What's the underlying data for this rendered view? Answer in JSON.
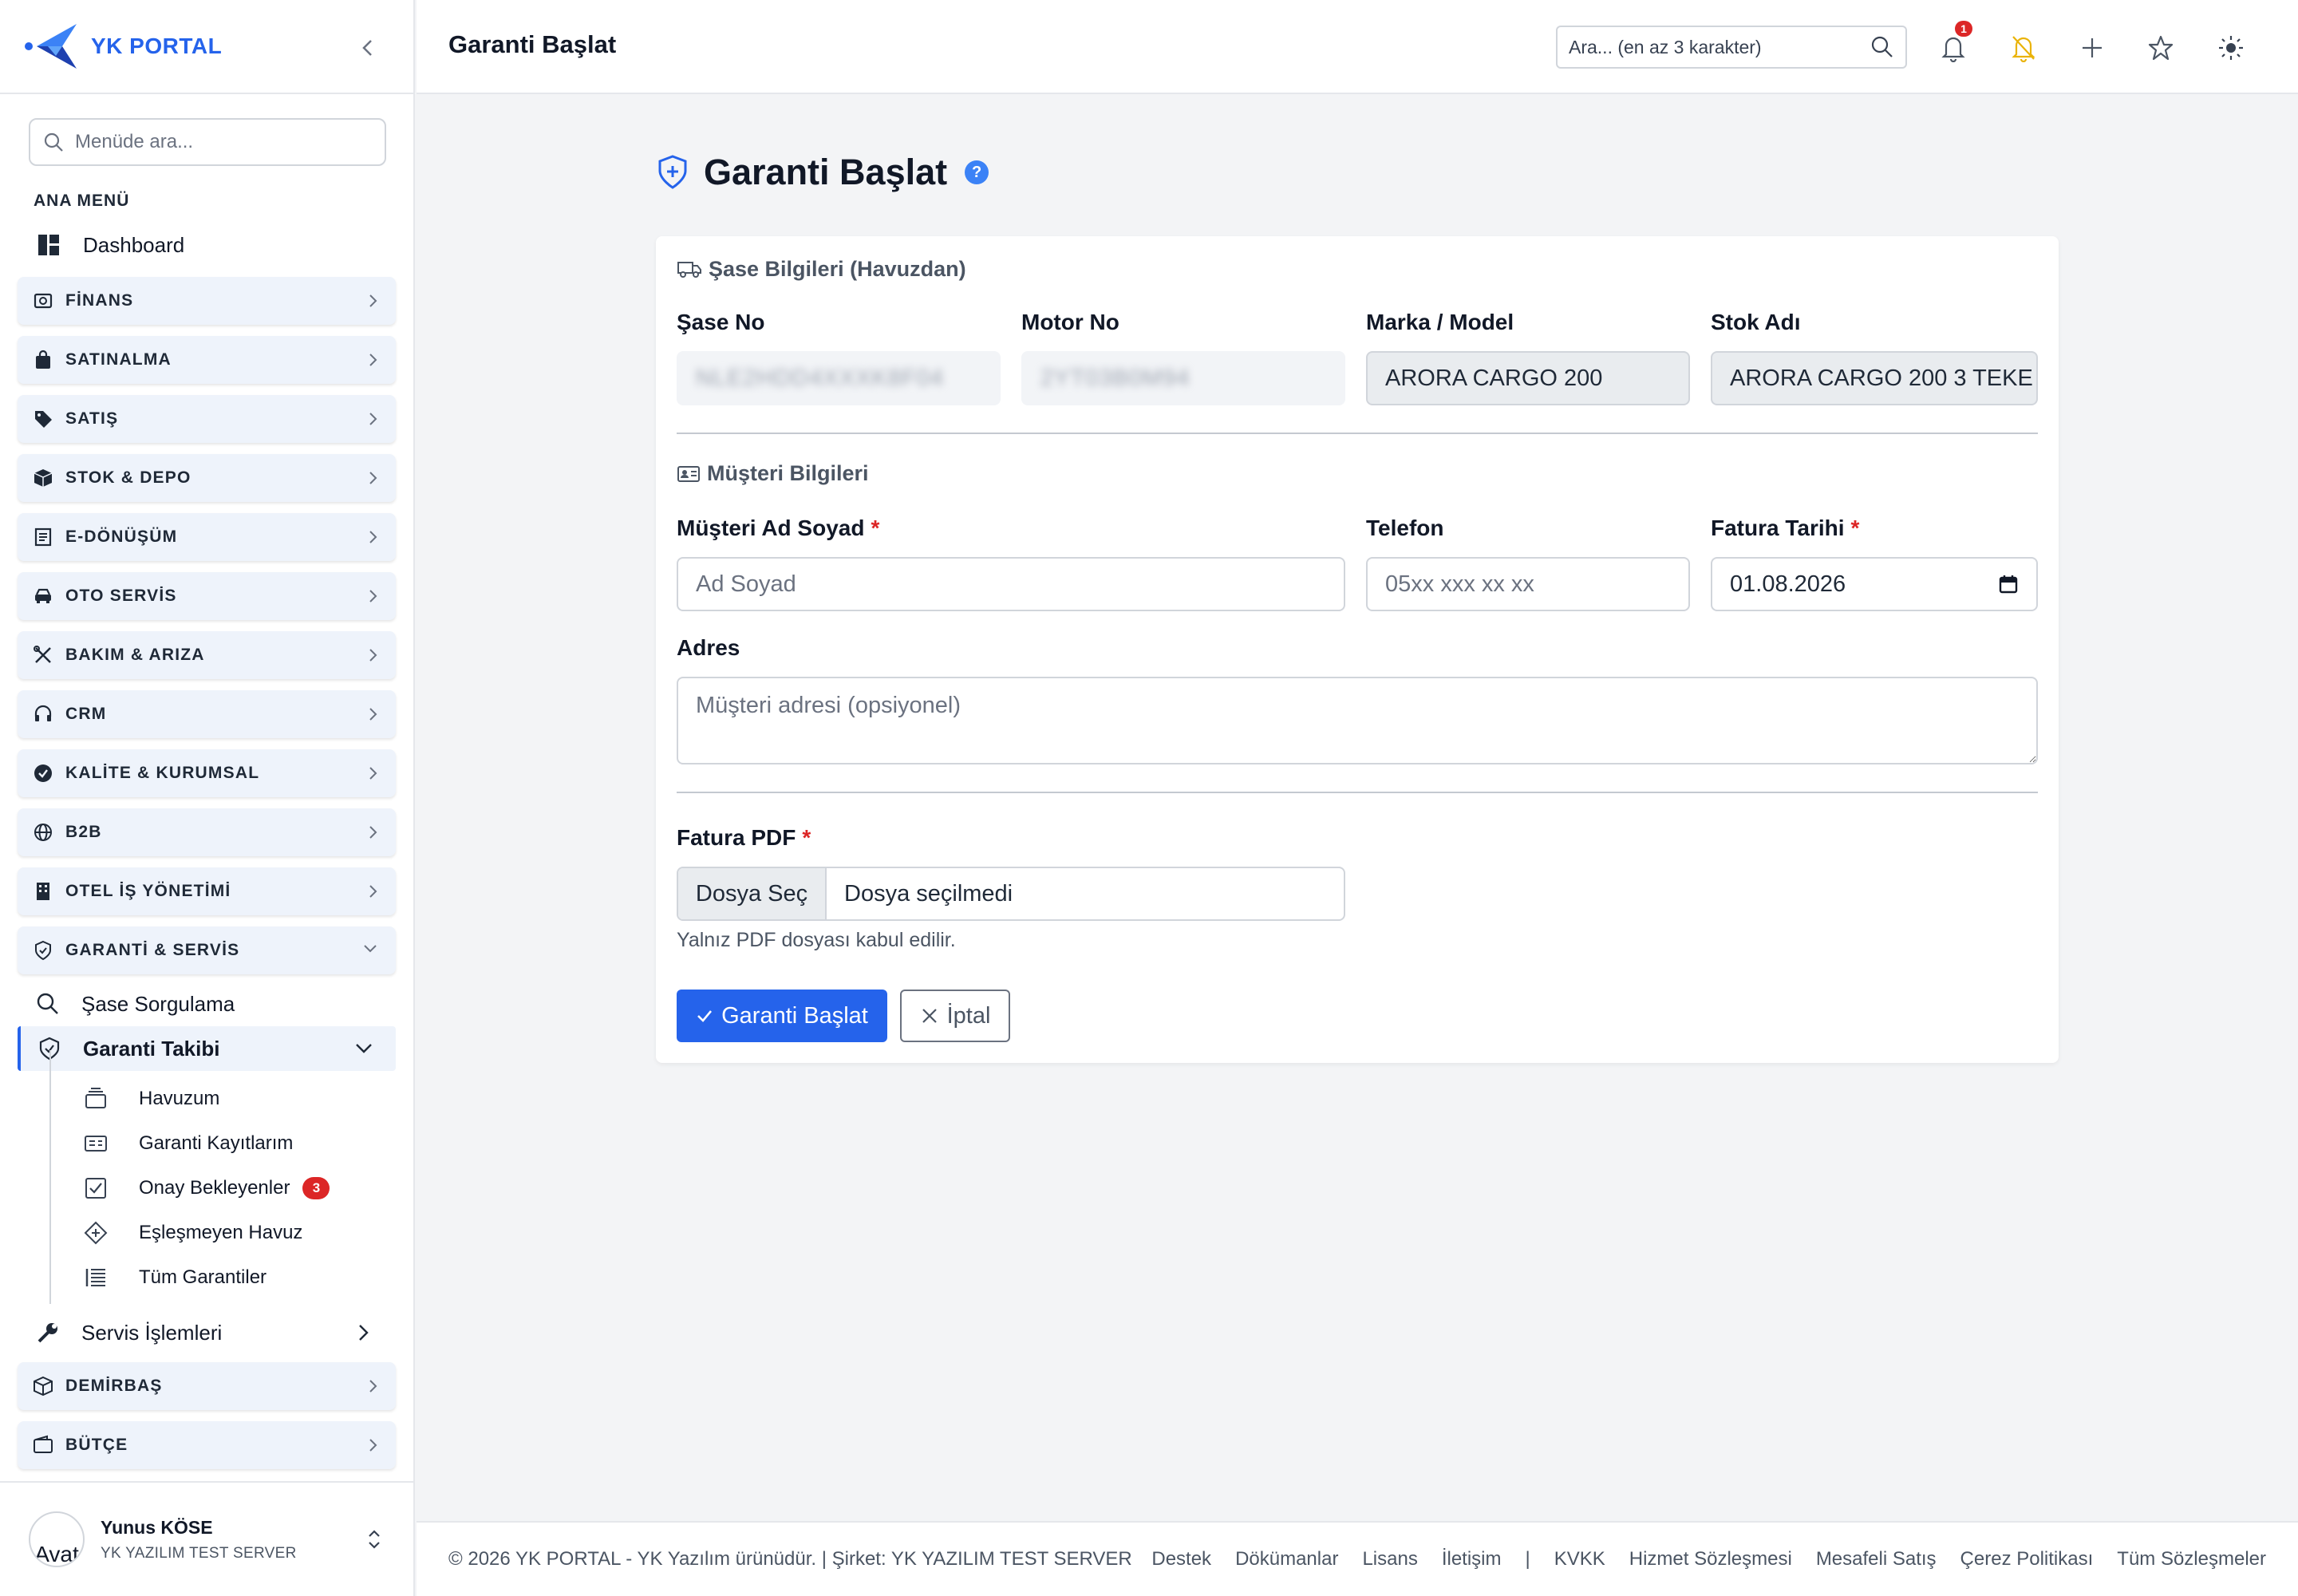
{
  "brand": {
    "name": "YK PORTAL"
  },
  "sidebar": {
    "search_placeholder": "Menüde ara...",
    "section_title": "ANA MENÜ",
    "dashboard_label": "Dashboard",
    "groups": [
      {
        "label": "FİNANS",
        "icon": "finance-icon"
      },
      {
        "label": "SATINALMA",
        "icon": "shopping-bag-icon"
      },
      {
        "label": "SATIŞ",
        "icon": "tag-icon"
      },
      {
        "label": "STOK & DEPO",
        "icon": "box-icon"
      },
      {
        "label": "E-DÖNÜŞÜM",
        "icon": "document-icon"
      },
      {
        "label": "OTO SERVİS",
        "icon": "car-icon"
      },
      {
        "label": "BAKIM & ARIZA",
        "icon": "tools-icon"
      },
      {
        "label": "CRM",
        "icon": "headset-icon"
      },
      {
        "label": "KALİTE & KURUMSAL",
        "icon": "check-badge-icon"
      },
      {
        "label": "B2B",
        "icon": "globe-icon"
      },
      {
        "label": "OTEL İŞ YÖNETİMİ",
        "icon": "building-icon"
      },
      {
        "label": "GARANTİ & SERVİS",
        "icon": "shield-icon"
      }
    ],
    "warranty": {
      "chassis_query": "Şase Sorgulama",
      "tracking": "Garanti Takibi",
      "children": [
        {
          "label": "Havuzum",
          "icon": "inbox-icon"
        },
        {
          "label": "Garanti Kayıtlarım",
          "icon": "id-card-icon"
        },
        {
          "label": "Onay Bekleyenler",
          "icon": "check-square-icon",
          "badge": "3"
        },
        {
          "label": "Eşleşmeyen Havuz",
          "icon": "diamond-icon"
        },
        {
          "label": "Tüm Garantiler",
          "icon": "list-icon"
        }
      ],
      "service_ops": "Servis İşlemleri"
    },
    "bottom_groups": [
      {
        "label": "DEMİRBAŞ",
        "icon": "box-icon"
      },
      {
        "label": "BÜTÇE",
        "icon": "wallet-icon"
      }
    ],
    "user": {
      "name": "Yunus KÖSE",
      "company": "YK YAZILIM TEST SERVER",
      "avatar_alt": "Avat"
    }
  },
  "topbar": {
    "title": "Garanti Başlat",
    "search_placeholder": "Ara... (en az 3 karakter)",
    "notification_count": "1"
  },
  "page": {
    "title": "Garanti Başlat",
    "help": "?",
    "chassis_section": "Şase Bilgileri (Havuzdan)",
    "fields": {
      "chassis_no_label": "Şase No",
      "chassis_no_value": "NLE2HDD4XXXK8F04",
      "motor_no_label": "Motor No",
      "motor_no_value": "2YT03B0M94",
      "brand_model_label": "Marka / Model",
      "brand_model_value": "ARORA CARGO 200",
      "stock_name_label": "Stok Adı",
      "stock_name_value": "ARORA CARGO 200 3 TEKE"
    },
    "customer_section": "Müşteri Bilgileri",
    "customer": {
      "name_label": "Müşteri Ad Soyad",
      "name_placeholder": "Ad Soyad",
      "phone_label": "Telefon",
      "phone_placeholder": "05xx xxx xx xx",
      "invoice_date_label": "Fatura Tarihi",
      "invoice_date_value": "01.08.2026",
      "address_label": "Adres",
      "address_placeholder": "Müşteri adresi (opsiyonel)"
    },
    "pdf": {
      "label": "Fatura PDF",
      "button": "Dosya Seç",
      "file_status": "Dosya seçilmedi",
      "hint": "Yalnız PDF dosyası kabul edilir."
    },
    "required_mark": "*",
    "submit_label": "Garanti Başlat",
    "cancel_label": "İptal"
  },
  "footer": {
    "copyright": "© 2026 YK PORTAL - YK Yazılım ürünüdür. | Şirket: YK YAZILIM TEST SERVER",
    "links": [
      "Destek",
      "Dökümanlar",
      "Lisans",
      "İletişim",
      "|",
      "KVKK",
      "Hizmet Sözleşmesi",
      "Mesafeli Satış",
      "Çerez Politikası",
      "Tüm Sözleşmeler"
    ]
  },
  "colors": {
    "accent": "#2563eb",
    "danger": "#dc2626",
    "group_bg": "#eef3fb",
    "warning": "#facc15"
  }
}
